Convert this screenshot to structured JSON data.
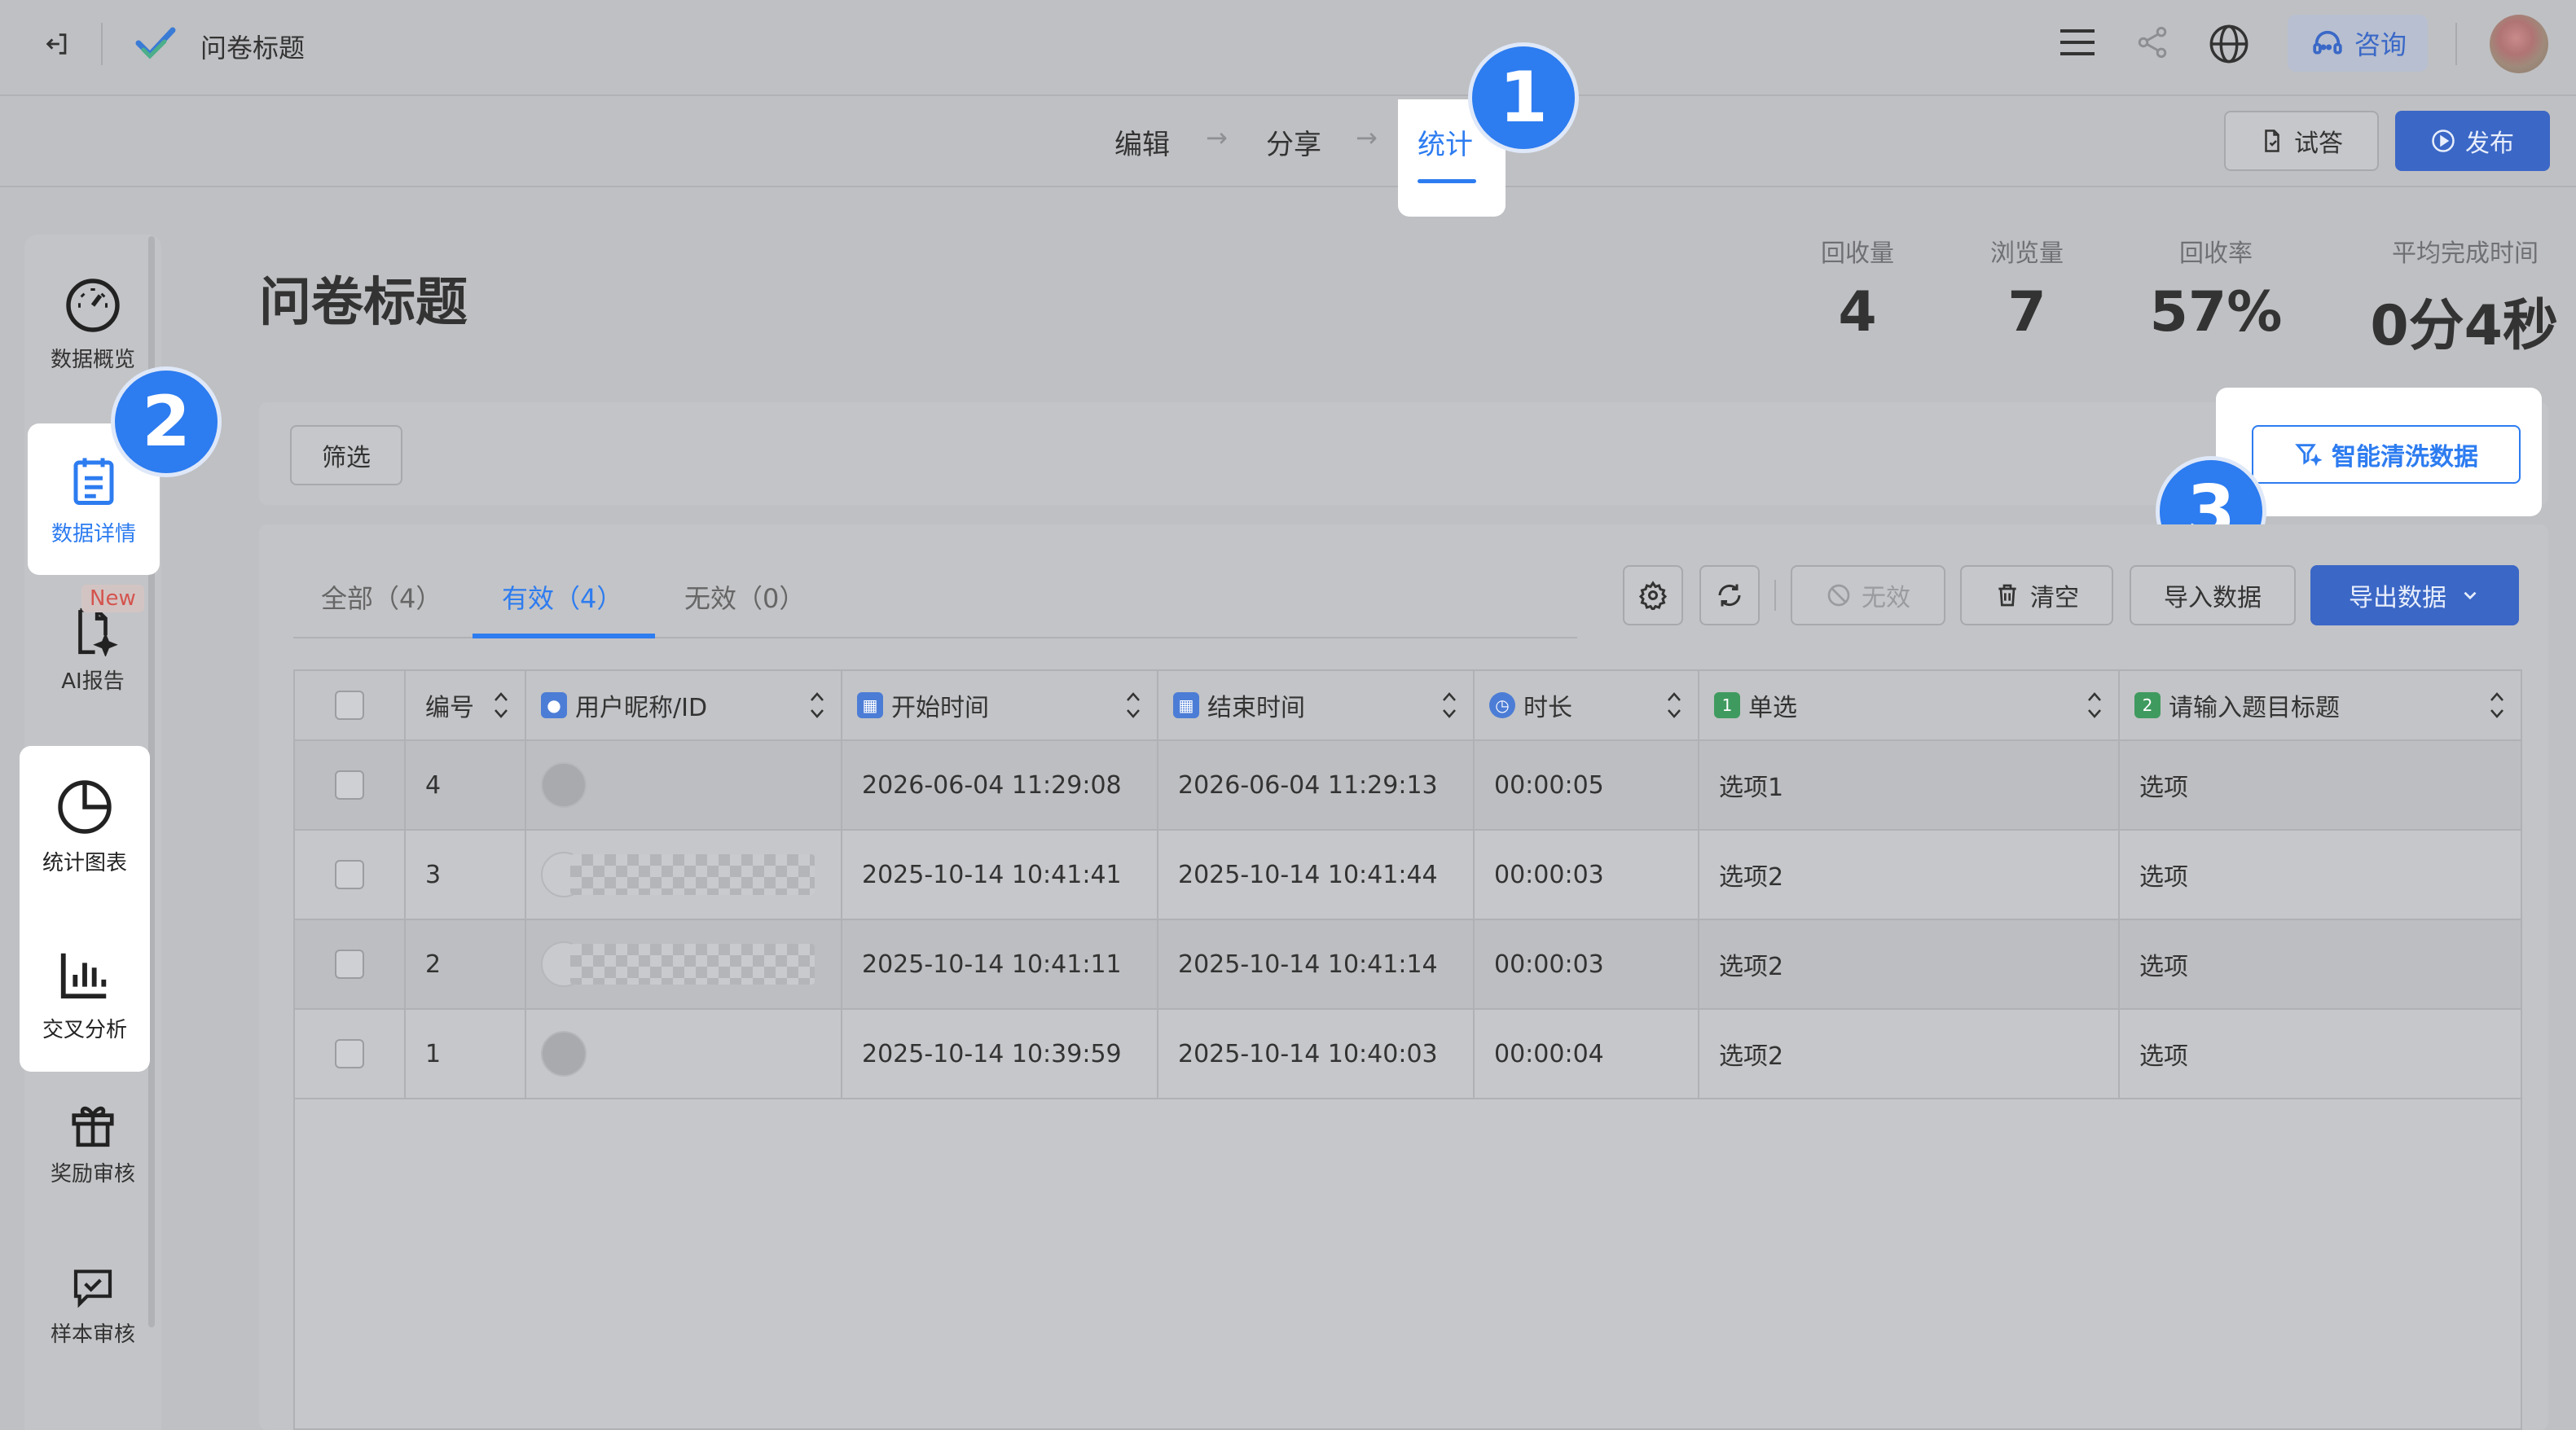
{
  "header": {
    "title": "问卷标题",
    "consult_label": "咨询"
  },
  "steps": {
    "edit": "编辑",
    "share": "分享",
    "stats": "统计"
  },
  "actions": {
    "try_label": "试答",
    "publish_label": "发布"
  },
  "page": {
    "title": "问卷标题",
    "metrics": [
      {
        "label": "回收量",
        "value": "4"
      },
      {
        "label": "浏览量",
        "value": "7"
      },
      {
        "label": "回收率",
        "value": "57%"
      },
      {
        "label": "平均完成时间",
        "value": "0分4秒"
      }
    ]
  },
  "filter": {
    "label": "筛选",
    "smart_clean_label": "智能清洗数据"
  },
  "sidebar": {
    "items": [
      {
        "label": "数据概览",
        "icon": "gauge-icon"
      },
      {
        "label": "数据详情",
        "icon": "clipboard-icon"
      },
      {
        "label": "AI报告",
        "icon": "ai-report-icon",
        "badge": "New"
      },
      {
        "label": "统计图表",
        "icon": "pie-chart-icon"
      },
      {
        "label": "交叉分析",
        "icon": "bar-chart-icon"
      },
      {
        "label": "奖励审核",
        "icon": "gift-icon"
      },
      {
        "label": "样本审核",
        "icon": "message-check-icon"
      }
    ]
  },
  "badges": {
    "b1": "1",
    "b2": "2",
    "b3": "3"
  },
  "tabs": [
    {
      "label": "全部（4）"
    },
    {
      "label": "有效（4）"
    },
    {
      "label": "无效（0）"
    }
  ],
  "toolbar": {
    "invalid_label": "无效",
    "clear_label": "清空",
    "import_label": "导入数据",
    "export_label": "导出数据"
  },
  "table": {
    "columns": [
      "编号",
      "用户昵称/ID",
      "开始时间",
      "结束时间",
      "时长",
      "单选",
      "请输入题目标题"
    ],
    "q1_num": "1",
    "q2_num": "2",
    "rows": [
      {
        "id": "4",
        "start": "2026-06-04 11:29:08",
        "end": "2026-06-04 11:29:13",
        "duration": "00:00:05",
        "single": "选项1",
        "q2": "选项"
      },
      {
        "id": "3",
        "start": "2025-10-14 10:41:41",
        "end": "2025-10-14 10:41:44",
        "duration": "00:00:03",
        "single": "选项2",
        "q2": "选项"
      },
      {
        "id": "2",
        "start": "2025-10-14 10:41:11",
        "end": "2025-10-14 10:41:14",
        "duration": "00:00:03",
        "single": "选项2",
        "q2": "选项"
      },
      {
        "id": "1",
        "start": "2025-10-14 10:39:59",
        "end": "2025-10-14 10:40:03",
        "duration": "00:00:04",
        "single": "选项2",
        "q2": "选项"
      }
    ]
  },
  "colors": {
    "accent": "#2d7cf0",
    "primary_button": "#3b67c6",
    "overlay": "#bfc0c3"
  }
}
